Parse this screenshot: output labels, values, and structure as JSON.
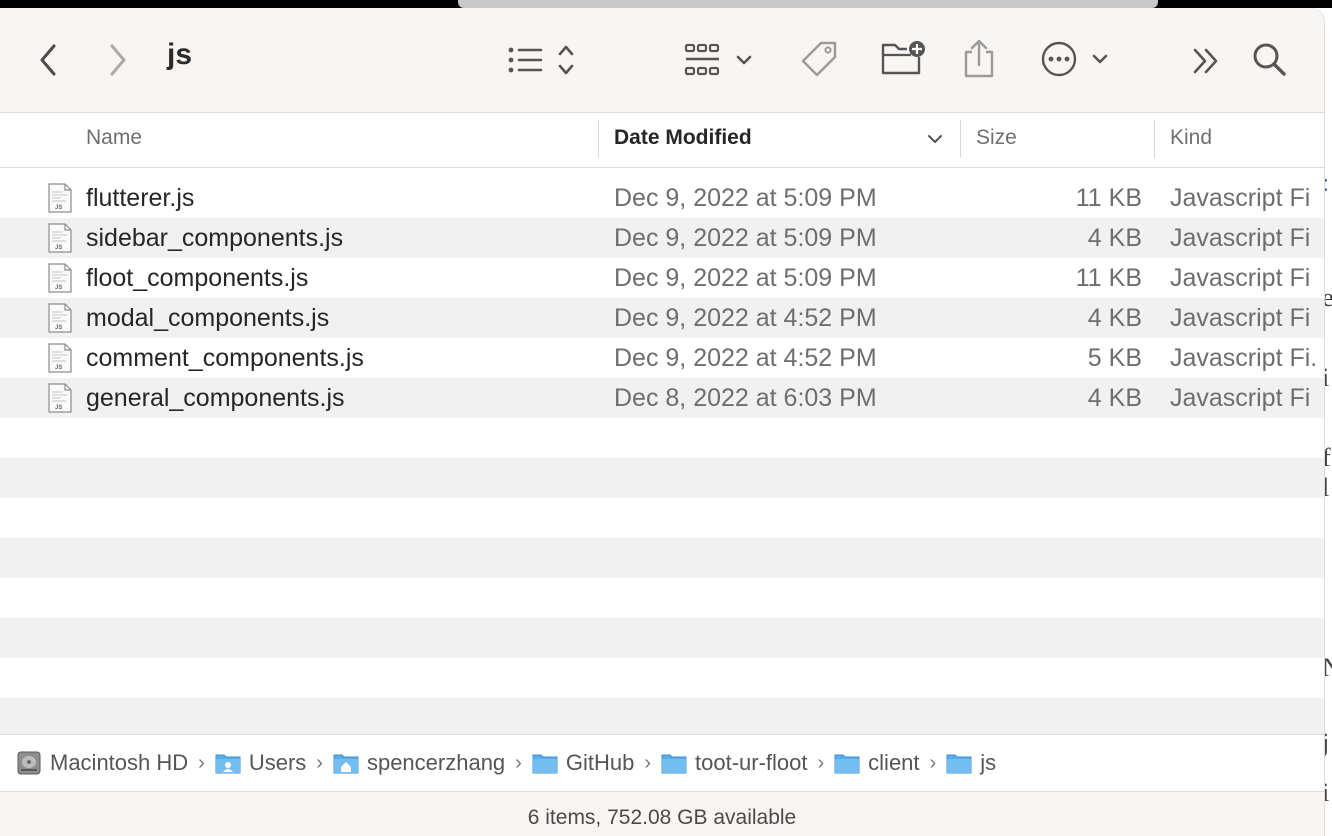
{
  "window": {
    "title": "js"
  },
  "toolbar": {
    "back": "chevron-left-icon",
    "forward": "chevron-right-icon",
    "view": "list-view-icon",
    "group": "grid-group-icon",
    "tag": "tag-icon",
    "new_folder": "new-folder-icon",
    "share": "share-icon",
    "more": "ellipsis-circle-icon",
    "overflow": "double-chevron-right-icon",
    "search": "search-icon"
  },
  "columns": {
    "name": "Name",
    "date": "Date Modified",
    "size": "Size",
    "kind": "Kind"
  },
  "files": [
    {
      "name": "flutterer.js",
      "date": "Dec 9, 2022 at 5:09 PM",
      "size": "11 KB",
      "kind": "Javascript Fi"
    },
    {
      "name": "sidebar_components.js",
      "date": "Dec 9, 2022 at 5:09 PM",
      "size": "4 KB",
      "kind": "Javascript Fi"
    },
    {
      "name": "floot_components.js",
      "date": "Dec 9, 2022 at 5:09 PM",
      "size": "11 KB",
      "kind": "Javascript Fi"
    },
    {
      "name": "modal_components.js",
      "date": "Dec 9, 2022 at 4:52 PM",
      "size": "4 KB",
      "kind": "Javascript Fi"
    },
    {
      "name": "comment_components.js",
      "date": "Dec 9, 2022 at 4:52 PM",
      "size": "5 KB",
      "kind": "Javascript Fi."
    },
    {
      "name": "general_components.js",
      "date": "Dec 8, 2022 at 6:03 PM",
      "size": "4 KB",
      "kind": "Javascript Fi"
    }
  ],
  "path": [
    "Macintosh HD",
    "Users",
    "spencerzhang",
    "GitHub",
    "toot-ur-floot",
    "client",
    "js"
  ],
  "status": "6 items, 752.08 GB available",
  "colors": {
    "folder": "#5aaee8",
    "toolbar_bg": "#f9f5f3",
    "alt_row": "#f0f1f0"
  }
}
